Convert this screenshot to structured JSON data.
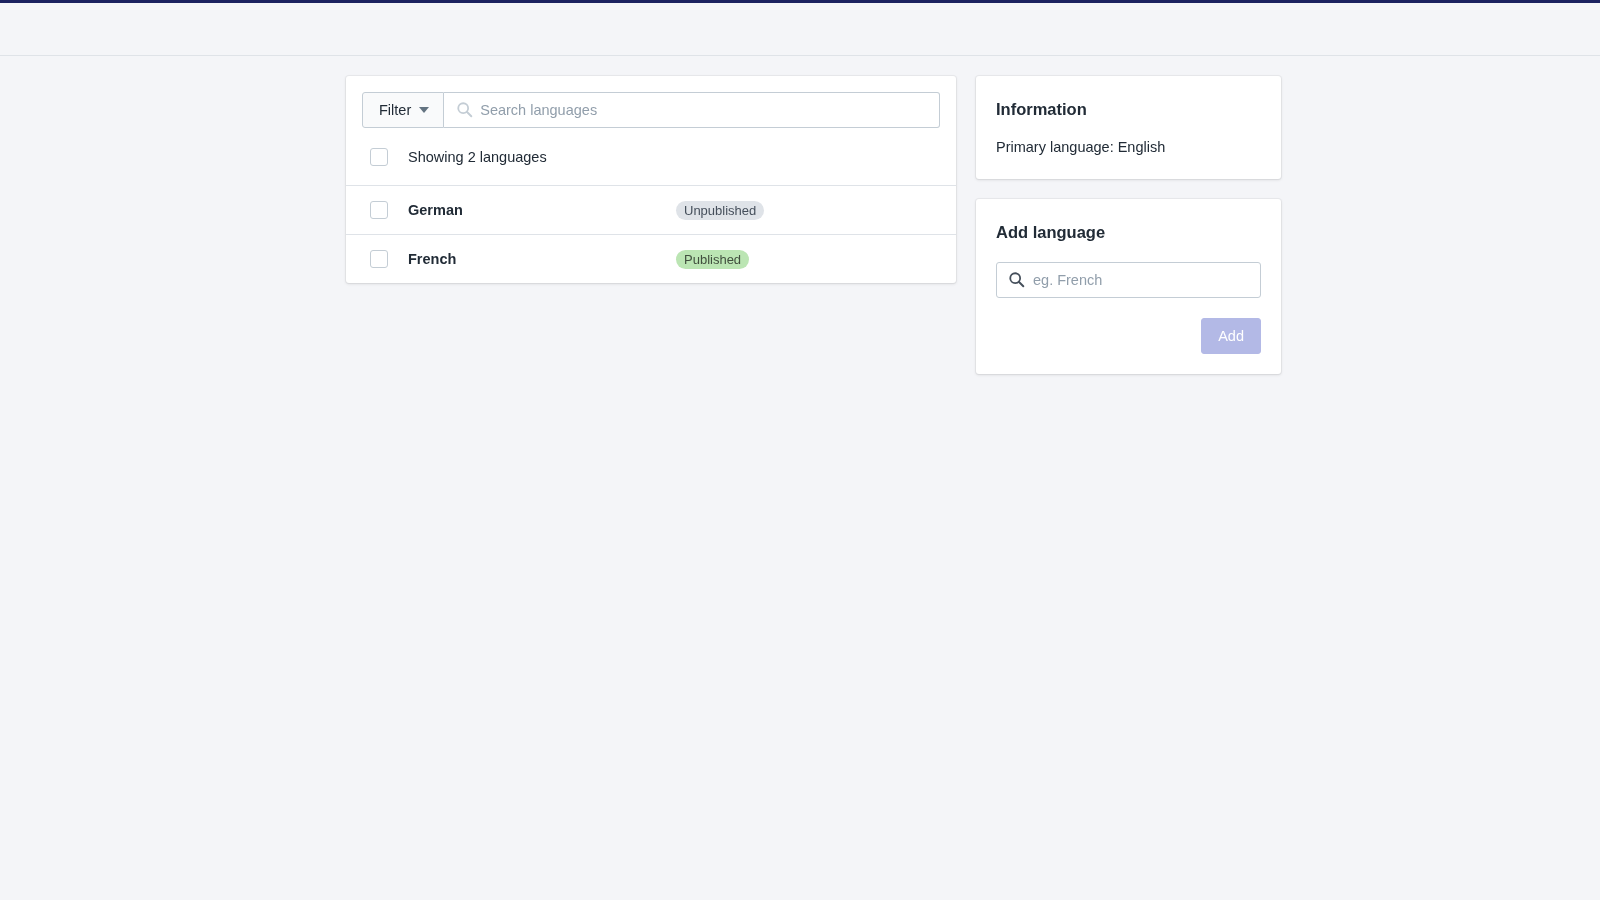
{
  "filter": {
    "label": "Filter"
  },
  "search": {
    "placeholder": "Search languages"
  },
  "list_header": {
    "text": "Showing 2 languages",
    "checked": false
  },
  "languages": [
    {
      "name": "German",
      "status": "Unpublished",
      "published": false,
      "checked": false
    },
    {
      "name": "French",
      "status": "Published",
      "published": true,
      "checked": false
    }
  ],
  "information": {
    "title": "Information",
    "text": "Primary language: English"
  },
  "add_language": {
    "title": "Add language",
    "placeholder": "eg. French",
    "button": "Add",
    "disabled": true
  }
}
